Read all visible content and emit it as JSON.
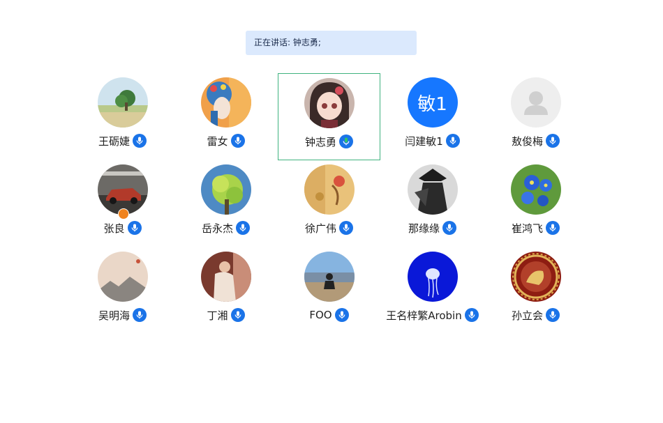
{
  "banner": {
    "label": "正在讲话:",
    "speaker": "钟志勇;"
  },
  "participants": [
    {
      "name": "王砺婕",
      "avatar": "landscape-tree"
    },
    {
      "name": "雷女",
      "avatar": "opera-portrait"
    },
    {
      "name": "钟志勇",
      "avatar": "anime-girl",
      "speaking": true
    },
    {
      "name": "闫建敏1",
      "avatar_text": "敏1",
      "avatar_color": "#1677ff"
    },
    {
      "name": "敖俊梅",
      "avatar": "default-user"
    },
    {
      "name": "张良",
      "avatar": "race-car",
      "host": true
    },
    {
      "name": "岳永杰",
      "avatar": "green-tree"
    },
    {
      "name": "徐广伟",
      "avatar": "painting"
    },
    {
      "name": "那缘缘",
      "avatar": "warrior"
    },
    {
      "name": "崔鸿飞",
      "avatar": "blue-flowers"
    },
    {
      "name": "吴明海",
      "avatar": "mountain-painting"
    },
    {
      "name": "丁湘",
      "avatar": "reading-woman"
    },
    {
      "name": "FOO",
      "avatar": "seaside-person"
    },
    {
      "name": "王名梓繁Arobin",
      "avatar": "jellyfish"
    },
    {
      "name": "孙立会",
      "avatar": "golden-medallion"
    }
  ],
  "colors": {
    "mic_active": "#1a73e8",
    "mic_speaking": "#2ec46a",
    "active_border": "#3fb27f"
  }
}
